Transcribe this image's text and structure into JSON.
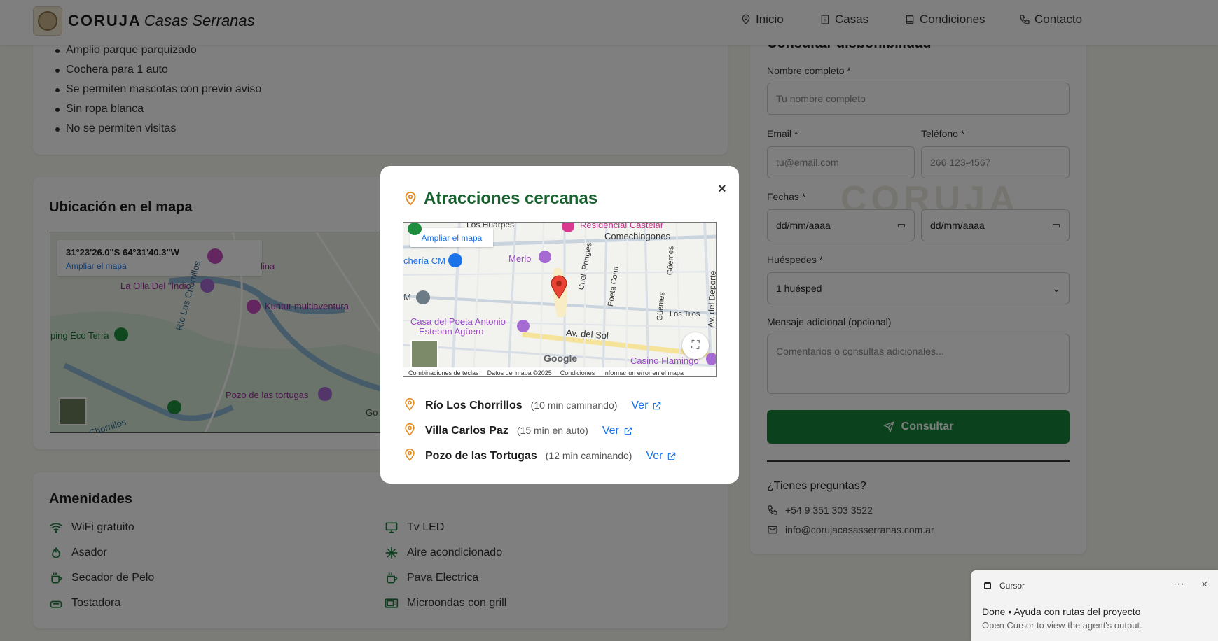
{
  "header": {
    "brand_bold": "CORUJA",
    "brand_italic": "Casas Serranas",
    "nav": [
      "Inicio",
      "Casas",
      "Condiciones",
      "Contacto"
    ]
  },
  "rules": [
    "Amplio parque parquizado",
    "Cochera para 1 auto",
    "Se permiten mascotas con previo aviso",
    "Sin ropa blanca",
    "No se permiten visitas"
  ],
  "location": {
    "title": "Ubicación en el mapa",
    "coords": "31°23'26.0\"S 64°31'40.3\"W",
    "expand_label": "Ampliar el mapa",
    "places": [
      "La Olla Del \"Indio\"",
      "Kuntur multiaventura",
      "Rio Los Chorrillos",
      "ping Eco Terra",
      "Pozo de las tortugas",
      "lina",
      "Los Chorrillos",
      "Go"
    ]
  },
  "amenities": {
    "title": "Amenidades",
    "items": [
      {
        "label": "WiFi gratuito",
        "icon": "wifi-icon"
      },
      {
        "label": "Tv LED",
        "icon": "tv-icon"
      },
      {
        "label": "Asador",
        "icon": "flame-icon"
      },
      {
        "label": "Aire acondicionado",
        "icon": "snowflake-icon"
      },
      {
        "label": "Secador de Pelo",
        "icon": "dryer-icon"
      },
      {
        "label": "Pava Electrica",
        "icon": "kettle-icon"
      },
      {
        "label": "Tostadora",
        "icon": "toaster-icon"
      },
      {
        "label": "Microondas con grill",
        "icon": "microwave-icon"
      }
    ]
  },
  "form": {
    "title": "Consultar disponibilidad",
    "name_label": "Nombre completo *",
    "name_placeholder": "Tu nombre completo",
    "email_label": "Email *",
    "email_placeholder": "tu@email.com",
    "phone_label": "Teléfono *",
    "phone_placeholder": "266 123-4567",
    "dates_label": "Fechas *",
    "date_placeholder": "dd/mm/aaaa",
    "guests_label": "Huéspedes *",
    "guests_value": "1 huésped",
    "message_label": "Mensaje adicional (opcional)",
    "message_placeholder": "Comentarios o consultas adicionales...",
    "submit": "Consultar",
    "questions_title": "¿Tienes preguntas?",
    "phone": "+54 9 351 303 3522",
    "email": "info@corujacasasserranas.com.ar",
    "watermark": "CORUJA"
  },
  "modal": {
    "title": "Atracciones cercanas",
    "close": "×",
    "map": {
      "expand_label": "Ampliar el mapa",
      "labels": [
        "Los Huarpes",
        "Residencial Castelar",
        "Comechingones",
        "Merlo",
        "chería CM",
        "Cnel. Pringles",
        "Güemes",
        "Poeta Conti",
        "Av. del Deporte",
        "Los Tilos",
        "Güemes",
        "Casa del Poeta Antonio",
        "Esteban Agüero",
        "Av. del Sol",
        "Casino Flamingo",
        "M"
      ],
      "footer": [
        "Combinaciones de teclas",
        "Datos del mapa ©2025",
        "Condiciones",
        "Informar un error en el mapa"
      ],
      "google": "Google"
    },
    "attractions": [
      {
        "name": "Río Los Chorrillos",
        "time": "(10 min caminando)",
        "link": "Ver"
      },
      {
        "name": "Villa Carlos Paz",
        "time": "(15 min en auto)",
        "link": "Ver"
      },
      {
        "name": "Pozo de las Tortugas",
        "time": "(12 min caminando)",
        "link": "Ver"
      }
    ]
  },
  "toast": {
    "app": "Cursor",
    "menu": "···",
    "close": "×",
    "line1": "Done • Ayuda con rutas del proyecto",
    "line2": "Open Cursor to view the agent's output."
  }
}
